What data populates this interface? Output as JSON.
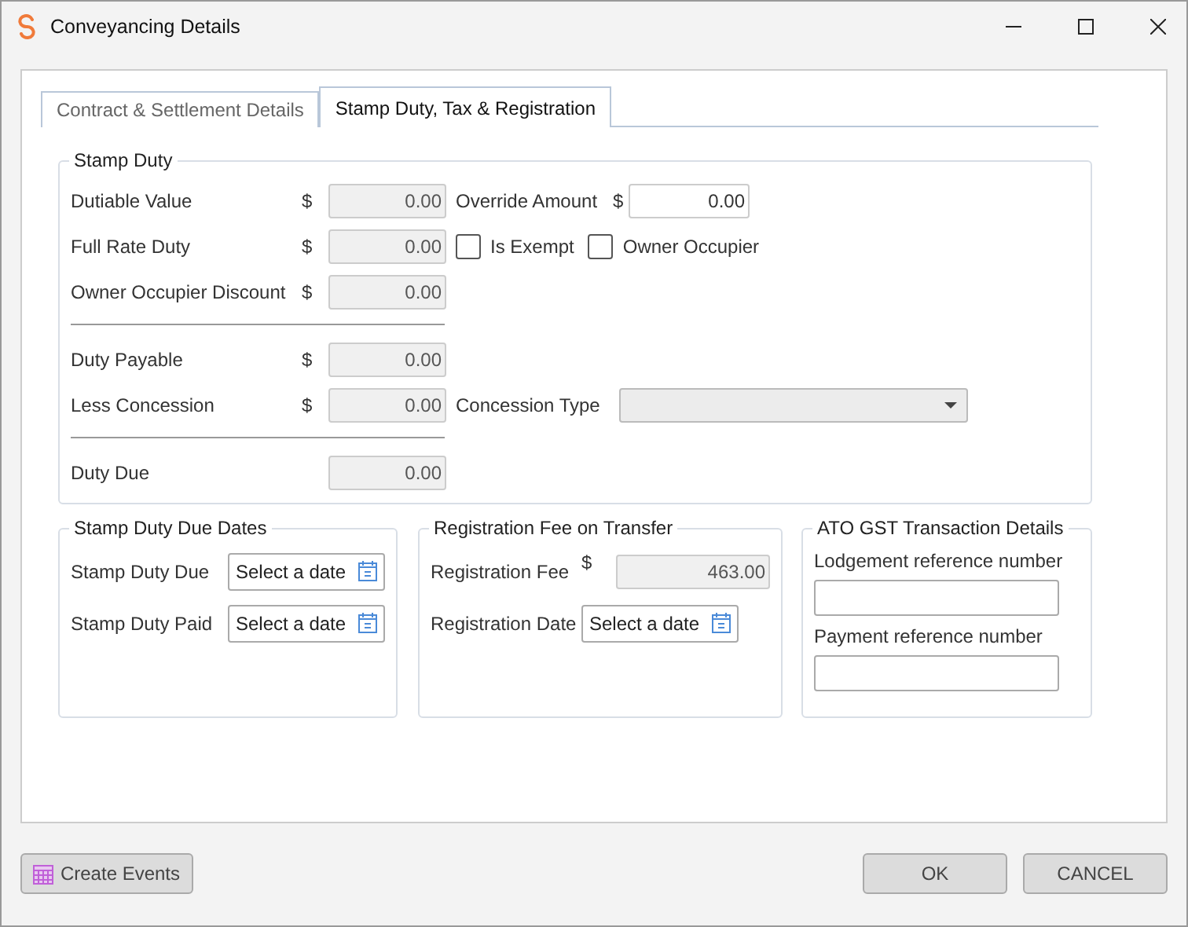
{
  "window": {
    "title": "Conveyancing Details"
  },
  "tabs": [
    {
      "label": "Contract & Settlement Details",
      "selected": false
    },
    {
      "label": "Stamp Duty, Tax & Registration",
      "selected": true
    }
  ],
  "stamp_duty": {
    "title": "Stamp Duty",
    "sections": [
      {
        "rows": [
          {
            "label": "Dutiable Value",
            "currency": "$",
            "value": "0.00",
            "disabled": true,
            "side": {
              "kind": "amount",
              "label": "Override Amount",
              "currency": "$",
              "value": "0.00",
              "disabled": false
            }
          },
          {
            "label": "Full Rate Duty",
            "currency": "$",
            "value": "0.00",
            "disabled": true,
            "side": {
              "kind": "checkboxes",
              "items": [
                {
                  "label": "Is Exempt",
                  "checked": false
                },
                {
                  "label": "Owner Occupier",
                  "checked": false
                }
              ]
            }
          },
          {
            "label": "Owner Occupier Discount",
            "currency": "$",
            "value": "0.00",
            "disabled": true
          }
        ]
      },
      {
        "rows": [
          {
            "label": "Duty Payable",
            "currency": "$",
            "value": "0.00",
            "disabled": true
          },
          {
            "label": "Less Concession",
            "currency": "$",
            "value": "0.00",
            "disabled": true,
            "side": {
              "kind": "dropdown",
              "label": "Concession Type",
              "disabled": true
            }
          }
        ]
      },
      {
        "rows": [
          {
            "label": "Duty Due",
            "value": "0.00",
            "disabled": true
          }
        ]
      }
    ]
  },
  "due_dates": {
    "title": "Stamp Duty Due Dates",
    "fields": [
      {
        "kind": "date",
        "label": "Stamp Duty Due",
        "placeholder": "Select a date"
      },
      {
        "kind": "date",
        "label": "Stamp Duty Paid",
        "placeholder": "Select a date"
      }
    ]
  },
  "registration": {
    "title": "Registration Fee on Transfer",
    "fields": [
      {
        "kind": "amount",
        "label": "Registration Fee",
        "currency": "$",
        "value": "463.00",
        "disabled": true
      },
      {
        "kind": "date",
        "label": "Registration Date",
        "placeholder": "Select a date"
      }
    ]
  },
  "ato_gst": {
    "title": "ATO GST Transaction Details",
    "fields": [
      {
        "label": "Lodgement reference number"
      },
      {
        "label": "Payment reference number"
      }
    ]
  },
  "footer": {
    "create_events": "Create Events",
    "ok": "OK",
    "cancel": "CANCEL"
  }
}
